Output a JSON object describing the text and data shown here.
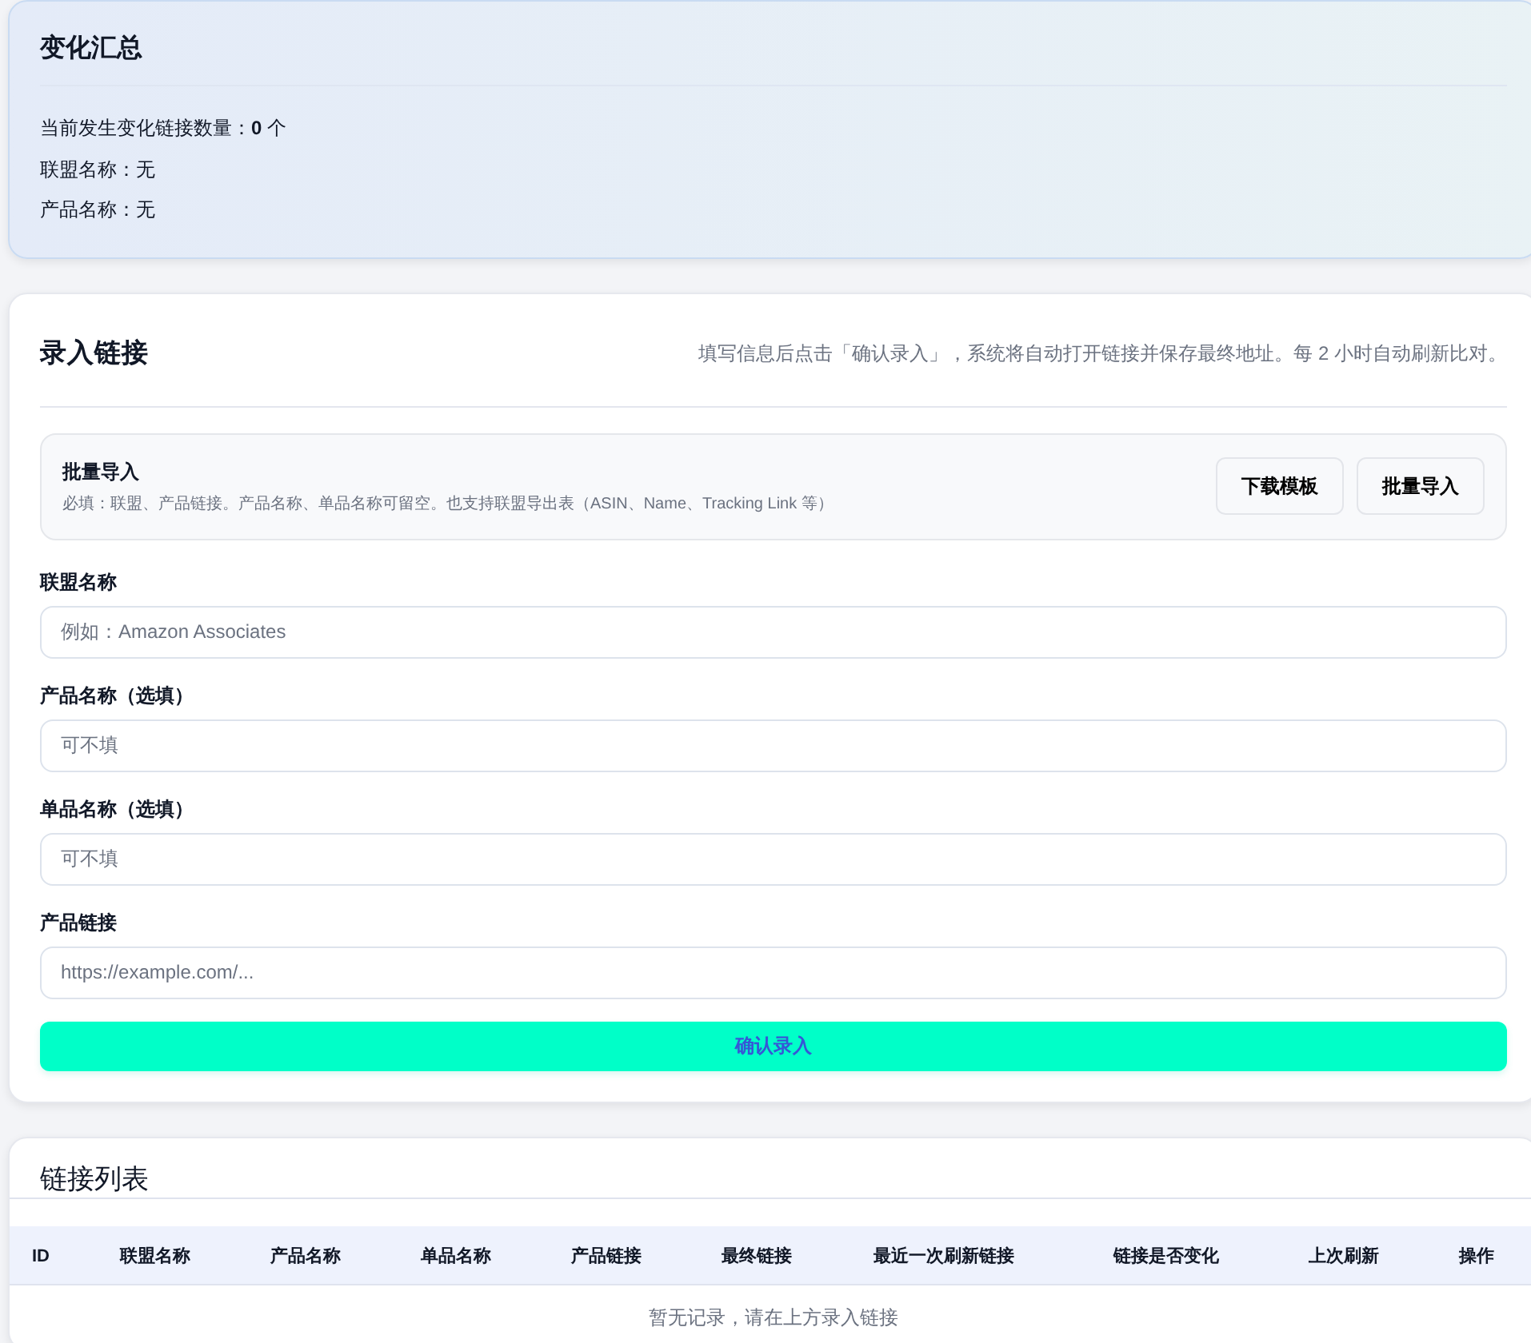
{
  "summary": {
    "title": "变化汇总",
    "lines": [
      "当前发生变化链接数量：**0** 个",
      "联盟名称：无",
      "产品名称：无"
    ]
  },
  "entry": {
    "title": "录入链接",
    "hint": "填写信息后点击「确认录入」，系统将自动打开链接并保存最终地址。每 2 小时自动刷新比对。",
    "batch_import": {
      "title": "批量导入",
      "note": "必填：联盟、产品链接。产品名称、单品名称可留空。也支持联盟导出表（ASIN、Name、Tracking Link 等）",
      "buttons": [
        "下载模板",
        "批量导入"
      ]
    },
    "fields": [
      {
        "label": "联盟名称",
        "placeholder": "例如：Amazon Associates"
      },
      {
        "label": "产品名称（选填）",
        "placeholder": "可不填"
      },
      {
        "label": "单品名称（选填）",
        "placeholder": "可不填"
      },
      {
        "label": "产品链接",
        "placeholder": "https://example.com/..."
      }
    ],
    "submit_button": "确认录入"
  },
  "link_list": {
    "title": "链接列表",
    "table": {
      "columns": [
        "ID",
        "联盟名称",
        "产品名称",
        "单品名称",
        "产品链接",
        "最终链接",
        "最近一次刷新链接",
        "链接是否变化",
        "上次刷新",
        "操作"
      ],
      "empty_message": "暂无记录，请在上方录入链接"
    }
  }
}
